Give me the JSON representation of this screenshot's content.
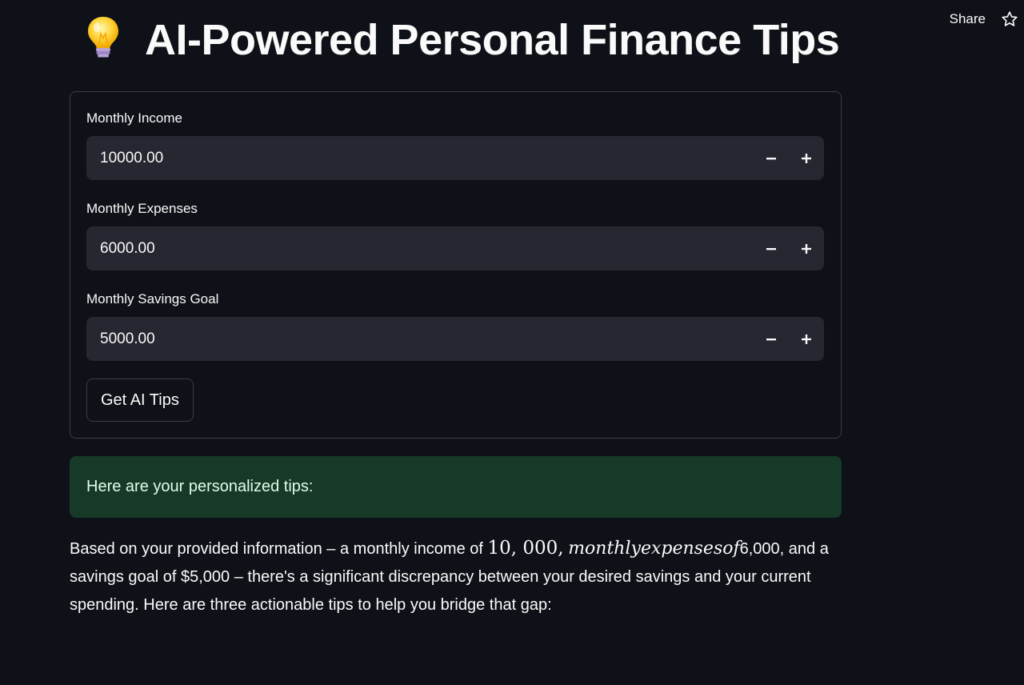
{
  "toolbar": {
    "share_label": "Share",
    "star_icon": "star-icon"
  },
  "header": {
    "icon": "lightbulb-icon",
    "title": "AI-Powered Personal Finance Tips"
  },
  "form": {
    "fields": [
      {
        "label": "Monthly Income",
        "value": "10000.00",
        "minus": "−",
        "plus": "+"
      },
      {
        "label": "Monthly Expenses",
        "value": "6000.00",
        "minus": "−",
        "plus": "+"
      },
      {
        "label": "Monthly Savings Goal",
        "value": "5000.00",
        "minus": "−",
        "plus": "+"
      }
    ],
    "submit_label": "Get AI Tips"
  },
  "result": {
    "success_message": "Here are your personalized tips:",
    "paragraph": {
      "part1": "Based on your provided information – a monthly income of ",
      "math_number": "10, 000,",
      "math_words": "monthlyexpensesof",
      "part2": "6,000, and a savings goal of $5,000 – there's a significant discrepancy between your desired savings and your current spending. Here are three actionable tips to help you bridge that gap:"
    }
  },
  "colors": {
    "background": "#0e1117",
    "input_bg": "#262730",
    "success_bg": "#173928",
    "success_text": "#dffde9",
    "border": "#3a3d45"
  }
}
